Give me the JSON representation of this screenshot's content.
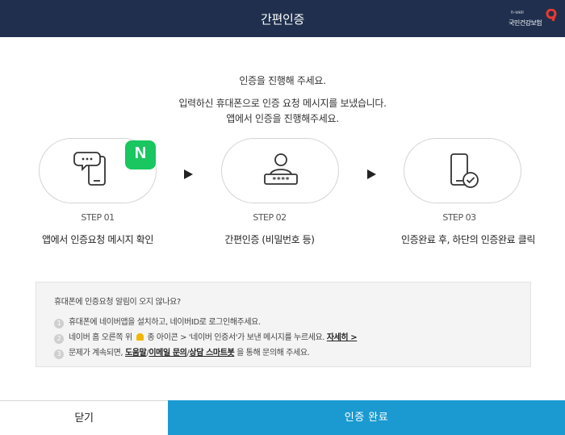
{
  "header": {
    "title": "간편인증",
    "logo": {
      "sub": "h-well",
      "text": "국민건강보험",
      "mark": "9",
      "accent": "#e83a2f"
    }
  },
  "intro": {
    "line1": "인증을 진행해 주세요.",
    "line2": "입력하신 휴대폰으로 인증 요청 메시지를 보냈습니다.",
    "line3": "앱에서 인증을 진행해주세요."
  },
  "steps": [
    {
      "label": "STEP 01",
      "desc": "앱에서 인증요청 메시지 확인",
      "icon": "phone-chat-icon",
      "badge": "N"
    },
    {
      "label": "STEP 02",
      "desc": "간편인증 (비밀번호 등)",
      "icon": "user-password-icon"
    },
    {
      "label": "STEP 03",
      "desc": "인증완료 후, 하단의 인증완료 클릭",
      "icon": "phone-check-icon"
    }
  ],
  "help": {
    "title": "휴대폰에 인증요청 알림이 오지 않나요?",
    "items": [
      {
        "num": "1",
        "text": "휴대폰에 네이버앱을 설치하고, 네이버ID로 로그인해주세요."
      },
      {
        "num": "2",
        "text_a": "네이버 홈 오른쪽 위",
        "text_b": "종 아이콘 > '네이버 인증서'가 보낸 메시지를 누르세요.",
        "link": "자세히 >"
      },
      {
        "num": "3",
        "text_a": "문제가 계속되면,",
        "link1": "도움말",
        "sep1": "/",
        "link2": "이메일 문의",
        "sep2": "/",
        "link3": "상담 스마트봇",
        "text_b": "을 통해 문의해 주세요."
      }
    ]
  },
  "buttons": {
    "close": "닫기",
    "done": "인증 완료"
  },
  "colors": {
    "header_bg": "#1f2f4d",
    "primary": "#1a9ad1",
    "naver": "#19c660"
  }
}
